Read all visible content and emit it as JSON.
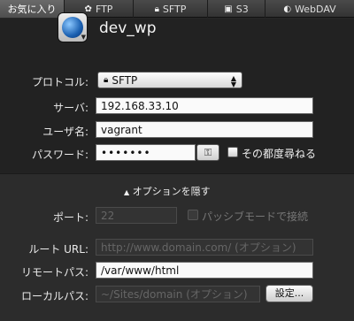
{
  "tabs": [
    {
      "label": "お気に入り",
      "icon": "heart-icon"
    },
    {
      "label": "FTP",
      "icon": "ftp-icon"
    },
    {
      "label": "SFTP",
      "icon": "lock-icon"
    },
    {
      "label": "S3",
      "icon": "s3-icon"
    },
    {
      "label": "WebDAV",
      "icon": "webdav-icon"
    }
  ],
  "site": {
    "name": "dev_wp"
  },
  "form": {
    "protocol_label": "プロトコル:",
    "protocol_value": "SFTP",
    "server_label": "サーバ:",
    "server_value": "192.168.33.10",
    "user_label": "ユーザ名:",
    "user_value": "vagrant",
    "password_label": "パスワード:",
    "password_value": "•••••••",
    "ask_label": "その都度尋ねる"
  },
  "options": {
    "toggle_label": "オプションを隠す",
    "port_label": "ポート:",
    "port_placeholder": "22",
    "passive_label": "パッシブモードで接続",
    "root_url_label": "ルート URL:",
    "root_url_placeholder": "http://www.domain.com/ (オプション)",
    "remote_path_label": "リモートパス:",
    "remote_path_value": "/var/www/html",
    "local_path_label": "ローカルパス:",
    "local_path_placeholder": "~/Sites/domain (オプション)",
    "settings_button": "設定..."
  },
  "colors": {
    "accent": "#1a5fb0"
  }
}
